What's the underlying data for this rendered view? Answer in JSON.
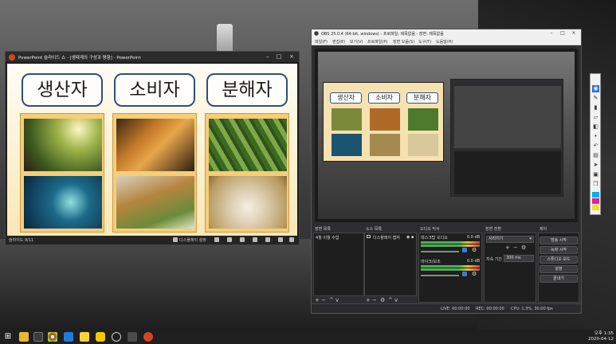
{
  "ppt": {
    "title": "PowerPoint 슬라이드 쇼 - [생태계의 구성과 평형] - PowerPoint",
    "concepts": [
      "생산자",
      "소비자",
      "분해자"
    ],
    "status_left": "슬라이드 9/11",
    "status_right": "디스플레이 설정"
  },
  "obs": {
    "title": "OBS 25.0.4 (64-bit, windows) - 프로파일: 제목없음 - 장면: 제목없음",
    "menu": [
      "파일(F)",
      "편집(E)",
      "보기(V)",
      "프로파일(P)",
      "장면 모음(S)",
      "도구(T)",
      "도움말(H)"
    ],
    "docks": {
      "scenes": "장면 목록",
      "sources": "소스 목록",
      "mixer": "오디오 믹서",
      "transitions": "장면 전환",
      "controls": "제어"
    },
    "scene_item": "4월 이월 수업",
    "source_item": "디스플레이 캡처",
    "mixer_channels": [
      {
        "name": "데스크탑 오디오",
        "db": "0.0 dB"
      },
      {
        "name": "마이크/보조",
        "db": "0.0 dB"
      }
    ],
    "transition_select": "사라지기",
    "duration_label": "지속 기간",
    "duration_value": "300 ms",
    "controls": [
      "방송 시작",
      "녹화 시작",
      "스튜디오 모드",
      "설정",
      "끝내기"
    ],
    "status": {
      "live": "LIVE: 00:00:00",
      "rec": "REC: 00:00:00",
      "cpu": "CPU: 1.3%, 30.00 fps"
    }
  },
  "clock": {
    "time": "오후 1:35",
    "date": "2020-04-12"
  }
}
